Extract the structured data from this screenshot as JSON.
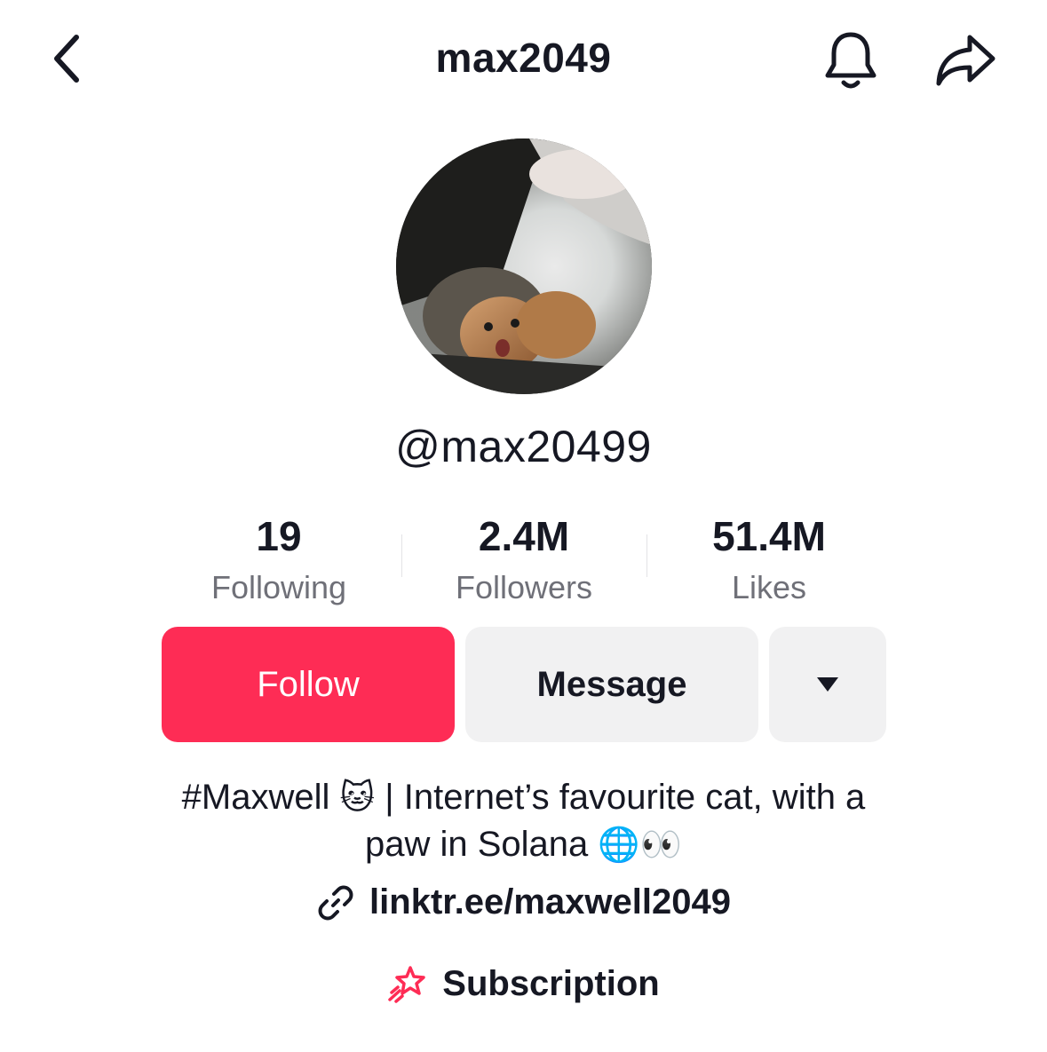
{
  "header": {
    "title": "max2049",
    "back_icon": "chevron-left-icon",
    "bell_icon": "bell-icon",
    "share_icon": "share-arrow-icon"
  },
  "profile": {
    "username": "@max20499"
  },
  "stats": [
    {
      "value": "19",
      "label": "Following"
    },
    {
      "value": "2.4M",
      "label": "Followers"
    },
    {
      "value": "51.4M",
      "label": "Likes"
    }
  ],
  "actions": {
    "follow_label": "Follow",
    "message_label": "Message",
    "more_icon": "triangle-down-icon"
  },
  "bio": {
    "line1_text": "#Maxwell ",
    "line1_emoji": "🐱",
    "line1_rest": "| Internet’s favourite cat, with a",
    "line2_text": "paw in Solana ",
    "line2_emoji": "🌐👀"
  },
  "link": {
    "url": "linktr.ee/maxwell2049",
    "icon": "link-icon"
  },
  "subscription": {
    "label": "Subscription",
    "icon": "subscription-star-icon"
  },
  "colors": {
    "accent": "#fe2c55",
    "secondary_button": "#f1f1f2",
    "text": "#161823",
    "muted": "#6f7078"
  }
}
